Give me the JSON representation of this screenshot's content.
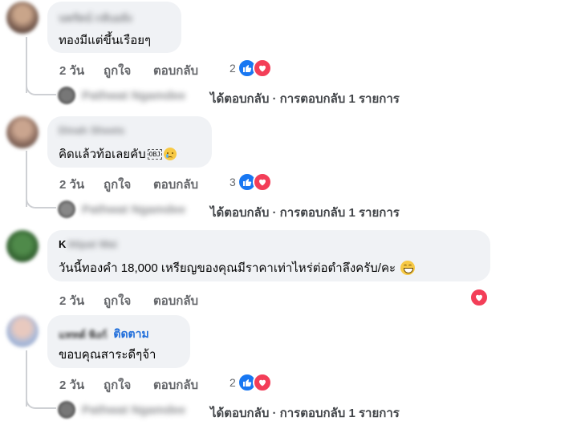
{
  "comments": [
    {
      "name": "นพรัตน์ กลับอลัง",
      "text": "ทองมีแต่ขึ้นเรือยๆ",
      "time": "2 วัน",
      "like_label": "ถูกใจ",
      "reply_label": "ตอบกลับ",
      "reaction_count": "2",
      "reply_author": "Pathwat Ngamdee",
      "reply_summary": "ได้ตอบกลับ · การตอบกลับ 1 รายการ"
    },
    {
      "name": "Dinah Sheets",
      "text": "คิดแล้วท้อเลยคับ",
      "text_glyph": "OBJ",
      "time": "2 วัน",
      "like_label": "ถูกใจ",
      "reply_label": "ตอบกลับ",
      "reaction_count": "3",
      "reply_author": "Pathwat Ngamdee",
      "reply_summary": "ได้ตอบกลับ · การตอบกลับ 1 รายการ"
    },
    {
      "name_initial": "K",
      "name_rest": "ittipat Wai",
      "text": "วันนี้ทองคำ 18,000 เหรียญของคุณมีราคาเท่าไหร่ต่อตำลึงครับ/คะ",
      "time": "2 วัน",
      "like_label": "ถูกใจ",
      "reply_label": "ตอบกลับ"
    },
    {
      "name": "แททต์ พิงก์",
      "follow_label": "ติดตาม",
      "text": "ขอบคุณสาระดีๆจ้า",
      "time": "2 วัน",
      "like_label": "ถูกใจ",
      "reply_label": "ตอบกลับ",
      "reaction_count": "2",
      "reply_author": "Pathwat Ngamdee",
      "reply_summary": "ได้ตอบกลับ · การตอบกลับ 1 รายการ"
    }
  ],
  "colors": {
    "like": "#1877f2",
    "love": "#f33e58",
    "bubble": "#f0f2f5",
    "link": "#216fdb"
  },
  "icons": [
    "like-reaction-icon",
    "love-reaction-icon",
    "sad-face-icon",
    "grin-face-icon"
  ]
}
